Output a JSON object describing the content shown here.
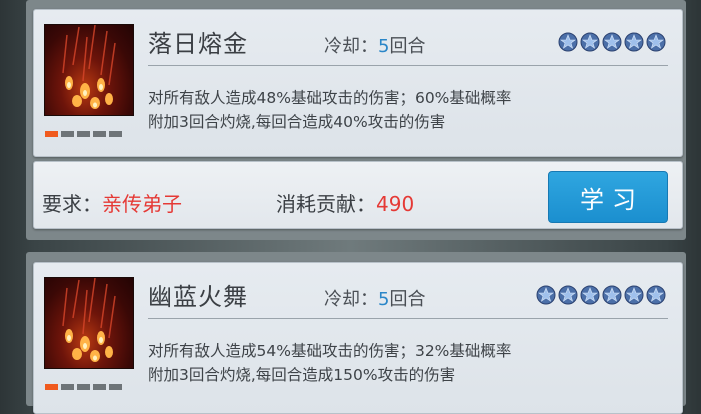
{
  "skills": [
    {
      "name": "落日熔金",
      "cooldown_label": "冷却：",
      "cooldown_value": "5",
      "cooldown_unit": "回合",
      "star_count": 5,
      "description_line1": "对所有敌人造成48%基础攻击的伤害；60%基础概率",
      "description_line2": "附加3回合灼烧,每回合造成40%攻击的伤害",
      "level_pips": [
        true,
        false,
        false,
        false,
        false
      ]
    },
    {
      "name": "幽蓝火舞",
      "cooldown_label": "冷却：",
      "cooldown_value": "5",
      "cooldown_unit": "回合",
      "star_count": 6,
      "description_line1": "对所有敌人造成54%基础攻击的伤害；32%基础概率",
      "description_line2": "附加3回合灼烧,每回合造成150%攻击的伤害",
      "level_pips": [
        true,
        false,
        false,
        false,
        false
      ]
    }
  ],
  "requirement": {
    "label": "要求：",
    "value": "亲传弟子",
    "cost_label": "消耗贡献：",
    "cost_value": "490",
    "button_label": "学习"
  },
  "colors": {
    "accent_blue": "#2a86c8",
    "button_blue": "#1b8fcf",
    "highlight_red": "#e53935",
    "pip_orange": "#f05a1e"
  }
}
